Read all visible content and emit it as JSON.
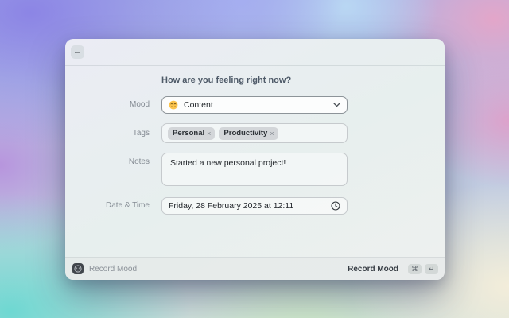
{
  "header": {
    "back_label": "←"
  },
  "form": {
    "title": "How are you feeling right now?",
    "mood": {
      "label": "Mood",
      "emoji": "😌",
      "emoji_icon": "relieved-face",
      "value": "Content"
    },
    "tags": {
      "label": "Tags",
      "items": [
        {
          "text": "Personal",
          "remove_icon": "×"
        },
        {
          "text": "Productivity",
          "remove_icon": "×"
        }
      ]
    },
    "notes": {
      "label": "Notes",
      "value": "Started a new personal project!"
    },
    "datetime": {
      "label": "Date & Time",
      "value": "Friday, 28 February 2025 at 12:11"
    }
  },
  "footer": {
    "app_name": "Record Mood",
    "action_label": "Record Mood",
    "shortcuts": [
      {
        "key": "⌘"
      },
      {
        "key": "↵"
      }
    ]
  },
  "colors": {
    "bg_purple": "#8c85e5",
    "bg_blue": "#b9d7f3",
    "bg_pink": "#e3a6c9",
    "bg_cream": "#f3edda",
    "bg_mint": "#cde8c8",
    "bg_teal": "#6ed8d2",
    "window_bg": "#e9eeee",
    "mood_emoji_yellow": "#fcc44d"
  }
}
